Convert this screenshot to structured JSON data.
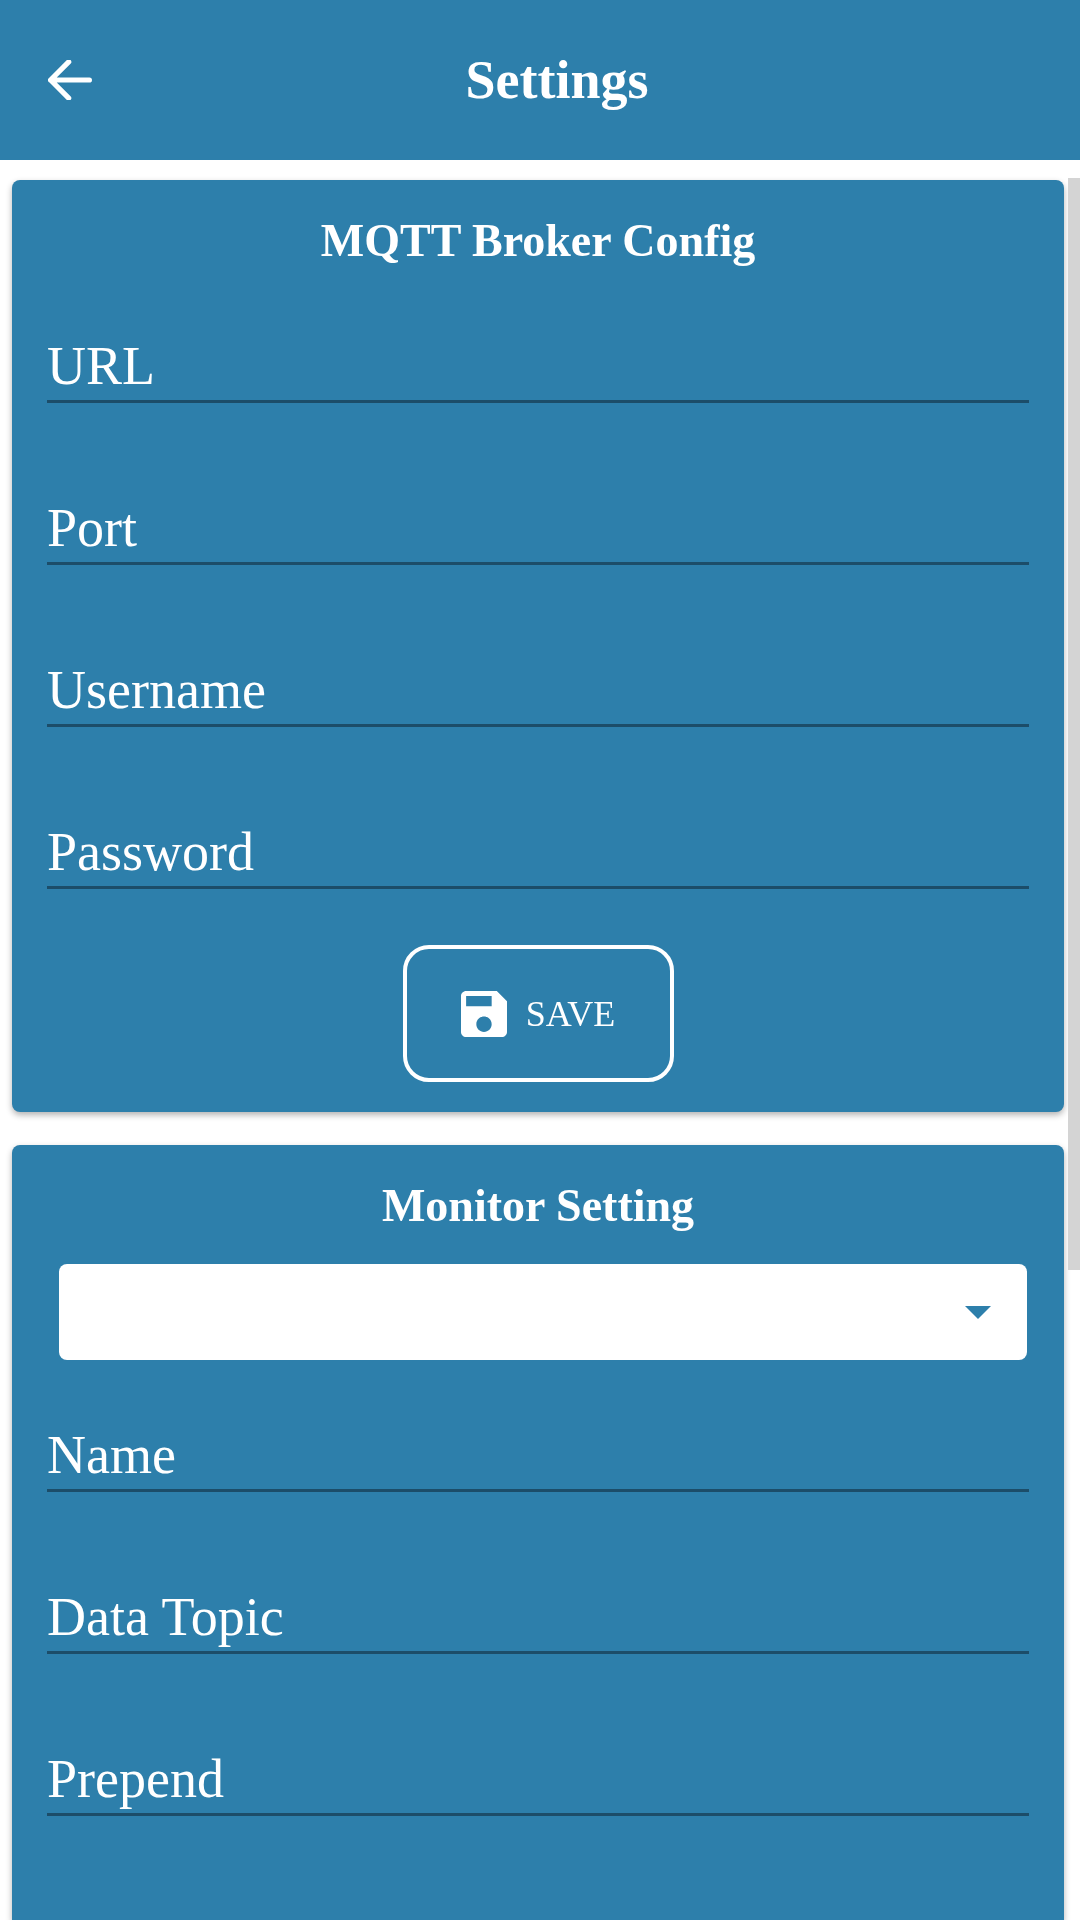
{
  "app_bar": {
    "title": "Settings"
  },
  "sections": [
    {
      "title": "MQTT Broker Config",
      "fields": [
        {
          "kind": "text",
          "placeholder": "URL"
        },
        {
          "kind": "text",
          "placeholder": "Port"
        },
        {
          "kind": "text",
          "placeholder": "Username"
        },
        {
          "kind": "text",
          "placeholder": "Password"
        }
      ],
      "button": {
        "label": "SAVE"
      }
    },
    {
      "title": "Monitor Setting",
      "fields": [
        {
          "kind": "dropdown"
        },
        {
          "kind": "text",
          "placeholder": "Name"
        },
        {
          "kind": "text",
          "placeholder": "Data Topic"
        },
        {
          "kind": "text",
          "placeholder": "Prepend"
        }
      ]
    }
  ]
}
